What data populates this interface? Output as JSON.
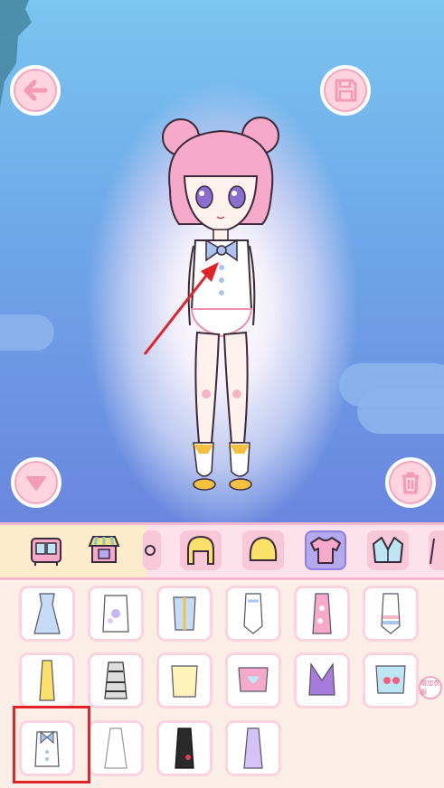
{
  "toolbar": {
    "back_icon": "arrow-left-icon",
    "save_icon": "floppy-disk-icon",
    "down_icon": "triangle-down-icon",
    "trash_icon": "trash-icon"
  },
  "colors": {
    "accent_pink": "#f6a7bd",
    "button_fill": "#ffd4de",
    "active_tab": "#b4a8ef",
    "selection_outline": "#e0242a",
    "annotation_arrow": "#e0242a"
  },
  "categories": [
    {
      "icon": "wardrobe-icon",
      "active": false
    },
    {
      "icon": "shop-icon",
      "active": false
    },
    {
      "icon": "hair-back-icon",
      "active": false
    },
    {
      "icon": "hair-front-icon",
      "active": false
    },
    {
      "icon": "shirt-icon",
      "active": true
    },
    {
      "icon": "jacket-icon",
      "active": false
    }
  ],
  "items": [
    {
      "icon": "blue-dress-icon"
    },
    {
      "icon": "floral-top-icon"
    },
    {
      "icon": "blue-corset-top-icon"
    },
    {
      "icon": "white-swimsuit-icon"
    },
    {
      "icon": "pink-cheongsam-icon"
    },
    {
      "icon": "pastel-swimsuit-icon"
    },
    {
      "icon": "yellow-knit-dress-icon"
    },
    {
      "icon": "gothic-dress-icon"
    },
    {
      "icon": "yellow-sweater-icon"
    },
    {
      "icon": "pink-heart-top-icon"
    },
    {
      "icon": "purple-wrap-top-icon"
    },
    {
      "icon": "strawberry-top-icon"
    },
    {
      "icon": "white-vest-bow-icon",
      "selected": true
    },
    {
      "icon": "white-gown-icon"
    },
    {
      "icon": "black-cheongsam-icon"
    },
    {
      "icon": "lilac-dress-icon"
    }
  ],
  "side_tag_text": "增加衣服"
}
